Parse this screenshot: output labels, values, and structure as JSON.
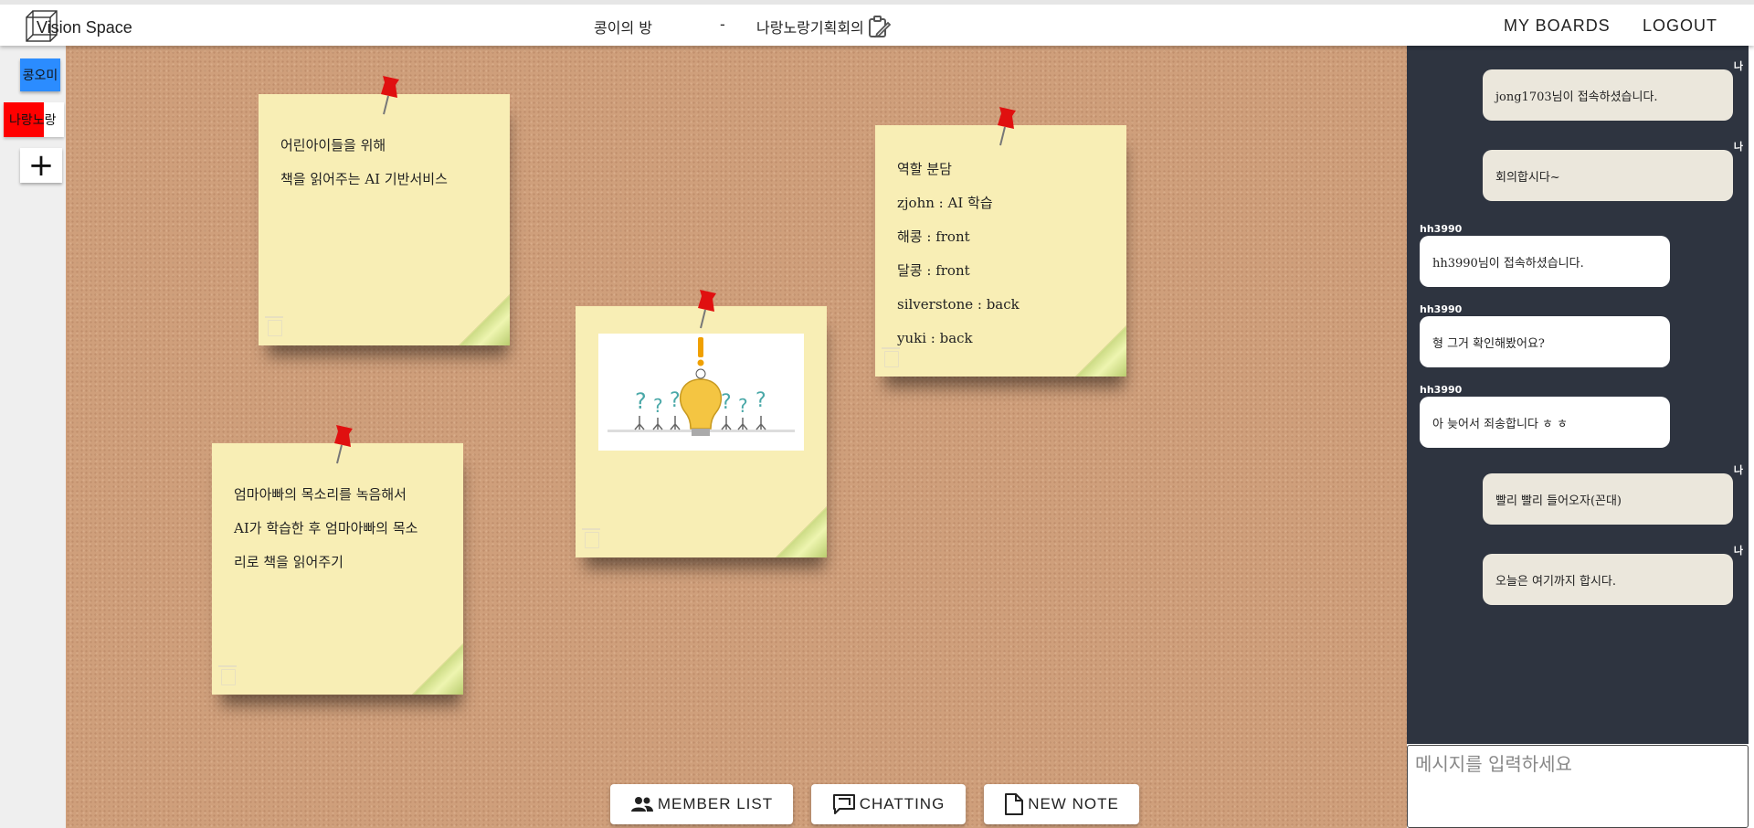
{
  "header": {
    "logo_text": "Vision Space",
    "room_name": "콩이의 방",
    "separator": "-",
    "board_name": "나랑노랑기획회의",
    "nav": {
      "my_boards": "MY BOARDS",
      "logout": "LOGOUT"
    }
  },
  "sidebar": {
    "rooms": [
      {
        "label": "콩오미",
        "color": "#2b8cff"
      },
      {
        "label": "나랑노랑",
        "color": "#ff0000"
      }
    ],
    "add_label": "+"
  },
  "notes": [
    {
      "lines": [
        "어린아이들을 위해",
        "책을 읽어주는 AI 기반서비스"
      ]
    },
    {
      "lines": [
        "엄마아빠의 목소리를 녹음해서",
        "AI가 학습한 후 엄마아빠의 목소",
        "리로 책을 읽어주기"
      ]
    },
    {
      "image": "lightbulb-idea-illustration"
    },
    {
      "lines": [
        "역할 분담",
        "zjohn : AI 학습",
        "해콩 : front",
        "달콩 : front",
        "silverstone : back",
        "yuki : back"
      ]
    }
  ],
  "bottom_buttons": {
    "members": "MEMBER LIST",
    "chatting": "CHATTING",
    "new_note": "NEW NOTE"
  },
  "chat": {
    "messages": [
      {
        "sender": "나",
        "text": "jong1703님이 접속하셨습니다.",
        "mine": true
      },
      {
        "sender": "나",
        "text": "회의합시다~",
        "mine": true
      },
      {
        "sender": "hh3990",
        "text": "hh3990님이 접속하셨습니다.",
        "mine": false
      },
      {
        "sender": "hh3990",
        "text": "형 그거 확인해봤어요?",
        "mine": false
      },
      {
        "sender": "hh3990",
        "text": "아 늦어서 죄송합니다 ㅎ ㅎ",
        "mine": false
      },
      {
        "sender": "나",
        "text": "빨리 빨리 들어오자(꼰대)",
        "mine": true
      },
      {
        "sender": "나",
        "text": "오늘은 여기까지 합시다.",
        "mine": true
      }
    ],
    "input_placeholder": "메시지를 입력하세요"
  }
}
